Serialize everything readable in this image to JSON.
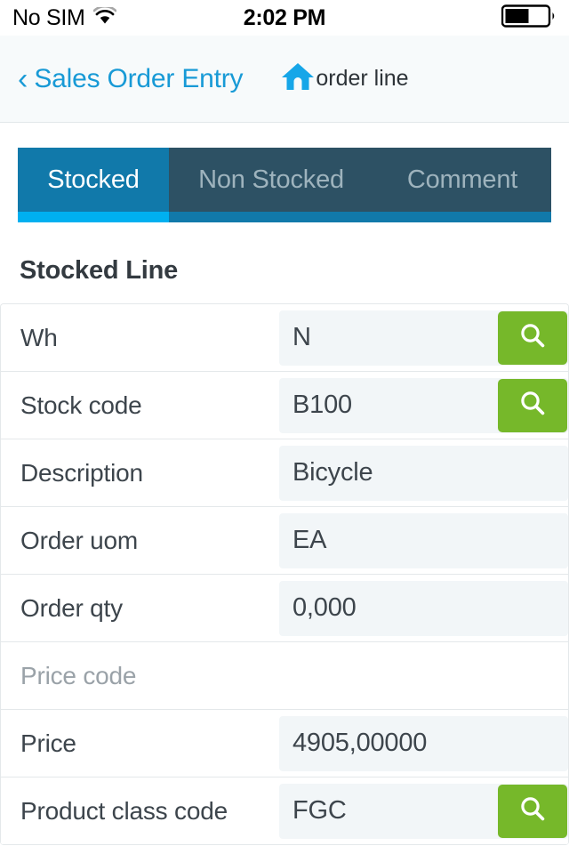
{
  "status_bar": {
    "carrier": "No SIM",
    "wifi_icon": "wifi-icon",
    "time": "2:02 PM",
    "battery_icon": "battery-icon",
    "battery_level_percent": 55
  },
  "nav_bar": {
    "back_chevron": "‹",
    "back_label": "Sales Order Entry",
    "home_icon": "home-icon",
    "title": "order line",
    "link_color": "#189ad6"
  },
  "tabs": {
    "items": [
      {
        "label": "Stocked",
        "active": true
      },
      {
        "label": "Non Stocked",
        "active": false
      },
      {
        "label": "Comment",
        "active": false
      }
    ],
    "active_bg": "#1179aa",
    "inactive_bg": "#2d5164",
    "underline_color": "#00b0f0"
  },
  "section": {
    "title": "Stocked Line"
  },
  "form": {
    "lookup_icon": "search-icon",
    "lookup_button_color": "#76b82a",
    "rows": [
      {
        "label": "Wh",
        "value": "N",
        "lookup": true,
        "muted": false,
        "has_field": true
      },
      {
        "label": "Stock code",
        "value": "B100",
        "lookup": true,
        "muted": false,
        "has_field": true
      },
      {
        "label": "Description",
        "value": "Bicycle",
        "lookup": false,
        "muted": false,
        "has_field": true
      },
      {
        "label": "Order uom",
        "value": "EA",
        "lookup": false,
        "muted": false,
        "has_field": true
      },
      {
        "label": "Order qty",
        "value": "0,000",
        "lookup": false,
        "muted": false,
        "has_field": true
      },
      {
        "label": "Price code",
        "value": "",
        "lookup": false,
        "muted": true,
        "has_field": false
      },
      {
        "label": "Price",
        "value": "4905,00000",
        "lookup": false,
        "muted": false,
        "has_field": true
      },
      {
        "label": "Product class code",
        "value": "FGC",
        "lookup": true,
        "muted": false,
        "has_field": true
      }
    ]
  }
}
